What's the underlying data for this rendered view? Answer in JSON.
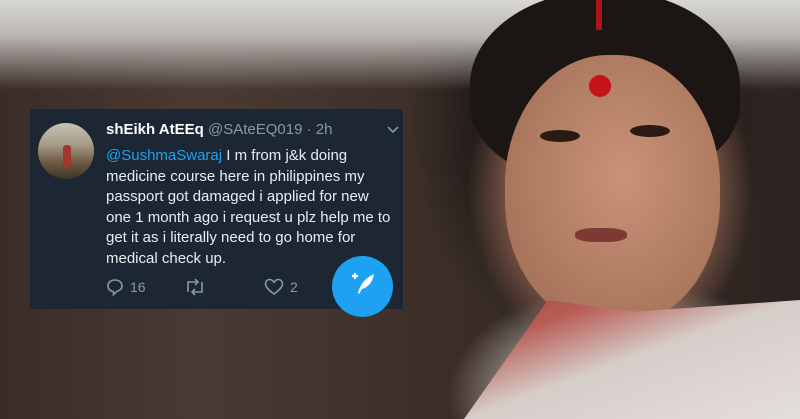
{
  "tweet": {
    "author_name": "shEikh AtEEq",
    "author_handle": "@SAteEQ019",
    "separator": "·",
    "time": "2h",
    "mention": "@SushmaSwaraj",
    "text": " I m from j&k doing medicine course here in philippines  my passport got damaged i applied for new one 1 month ago i request u plz help me to get it as i literally need to go home for medical check up.",
    "reply_count": "16",
    "retweet_count": "",
    "like_count": "2"
  },
  "colors": {
    "card_bg": "#1c2733",
    "accent": "#1da1f2",
    "muted": "#8899a6"
  },
  "icons": {
    "reply": "reply-icon",
    "retweet": "retweet-icon",
    "like": "heart-icon",
    "compose": "compose-tweet-icon",
    "menu": "chevron-down-icon"
  }
}
